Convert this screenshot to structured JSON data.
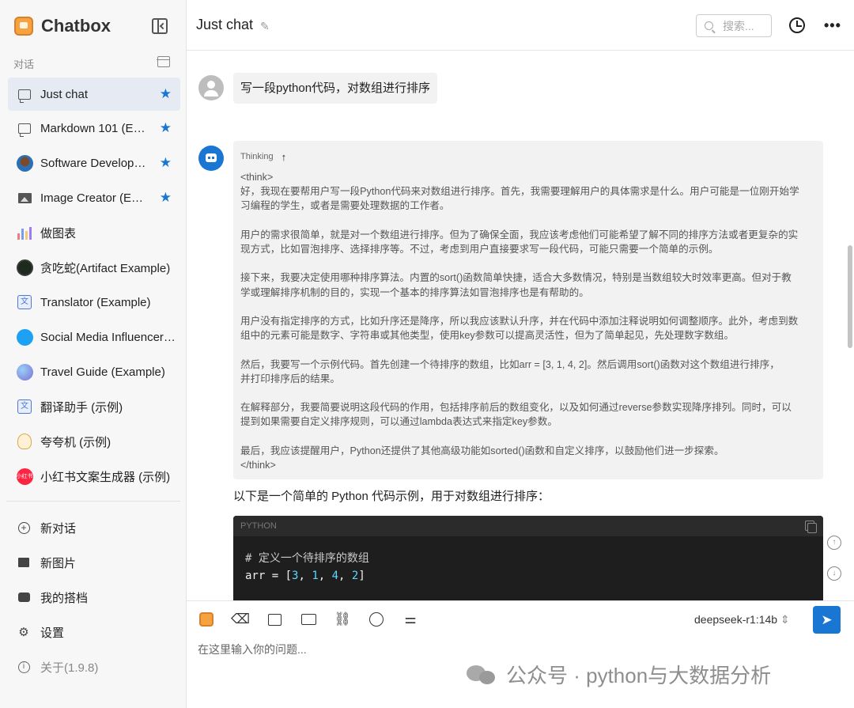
{
  "app": {
    "title": "Chatbox",
    "version_label": "关于(1.9.8)"
  },
  "sidebar": {
    "section_label": "对话",
    "sessions": [
      {
        "label": "Just chat",
        "starred": true,
        "icon": "chat-bubble-icon"
      },
      {
        "label": "Markdown 101 (Ex…",
        "starred": true,
        "icon": "chat-bubble-icon"
      },
      {
        "label": "Software Develop…",
        "starred": true,
        "icon": "developer-avatar"
      },
      {
        "label": "Image Creator (Ex…",
        "starred": true,
        "icon": "image-icon"
      },
      {
        "label": "做图表",
        "starred": false,
        "icon": "chart-avatar"
      },
      {
        "label": "贪吃蛇(Artifact Example)",
        "starred": false,
        "icon": "snake-avatar"
      },
      {
        "label": "Translator (Example)",
        "starred": false,
        "icon": "translator-avatar"
      },
      {
        "label": "Social Media Influencer …",
        "starred": false,
        "icon": "twitter-avatar"
      },
      {
        "label": "Travel Guide (Example)",
        "starred": false,
        "icon": "globe-avatar"
      },
      {
        "label": "翻译助手 (示例)",
        "starred": false,
        "icon": "translator-avatar"
      },
      {
        "label": "夸夸机 (示例)",
        "starred": false,
        "icon": "praise-avatar"
      },
      {
        "label": "小红书文案生成器 (示例)",
        "starred": false,
        "icon": "xiaohongshu-avatar"
      }
    ],
    "menu": {
      "new_chat": "新对话",
      "new_image": "新图片",
      "my_copilots": "我的搭档",
      "settings": "设置"
    }
  },
  "header": {
    "chat_title": "Just chat",
    "search_placeholder": "搜索..."
  },
  "messages": {
    "user_text": "写一段python代码，对数组进行排序",
    "thinking_label": "Thinking",
    "thinking_text": "<think>\n好，我现在要帮用户写一段Python代码来对数组进行排序。首先，我需要理解用户的具体需求是什么。用户可能是一位刚开始学\n习编程的学生，或者是需要处理数据的工作者。\n\n用户的需求很简单，就是对一个数组进行排序。但为了确保全面，我应该考虑他们可能希望了解不同的排序方法或者更复杂的实\n现方式，比如冒泡排序、选择排序等。不过，考虑到用户直接要求写一段代码，可能只需要一个简单的示例。\n\n接下来，我要决定使用哪种排序算法。内置的sort()函数简单快捷，适合大多数情况，特别是当数组较大时效率更高。但对于教\n学或理解排序机制的目的，实现一个基本的排序算法如冒泡排序也是有帮助的。\n\n用户没有指定排序的方式，比如升序还是降序，所以我应该默认升序，并在代码中添加注释说明如何调整顺序。此外，考虑到数\n组中的元素可能是数字、字符串或其他类型，使用key参数可以提高灵活性，但为了简单起见，先处理数字数组。\n\n然后，我要写一个示例代码。首先创建一个待排序的数组，比如arr = [3, 1, 4, 2]。然后调用sort()函数对这个数组进行排序，\n并打印排序后的结果。\n\n在解释部分，我要简要说明这段代码的作用，包括排序前后的数组变化，以及如何通过reverse参数实现降序排列。同时，可以\n提到如果需要自定义排序规则，可以通过lambda表达式来指定key参数。\n\n最后，我应该提醒用户，Python还提供了其他高级功能如sorted()函数和自定义排序，以鼓励他们进一步探索。\n</think>",
    "answer_intro": "以下是一个简单的 Python 代码示例，用于对数组进行排序：",
    "code_lang": "PYTHON",
    "code_comment": "# 定义一个待排序的数组",
    "code_var": "arr",
    "code_op": " = [",
    "code_values": [
      "3",
      "1",
      "4",
      "2"
    ]
  },
  "composer": {
    "model": "deepseek-r1:14b",
    "placeholder": "在这里输入你的问题...",
    "watermark": "公众号 · python与大数据分析"
  },
  "colors": {
    "accent": "#1976d2",
    "active_session": "#e6ebf3",
    "code_bg": "#1e1e1e"
  }
}
